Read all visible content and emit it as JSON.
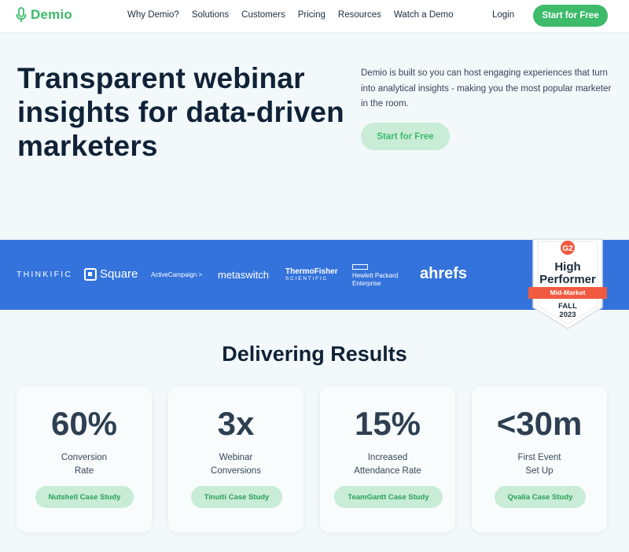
{
  "nav": {
    "logo_text": "Demio",
    "links": [
      "Why Demio?",
      "Solutions",
      "Customers",
      "Pricing",
      "Resources",
      "Watch a Demo"
    ],
    "login": "Login",
    "cta": "Start for Free"
  },
  "hero": {
    "title": "Transparent webinar insights for data-driven marketers",
    "description": "Demio is built so you can host engaging experiences that turn into analytical insights - making you the most popular marketer in the room.",
    "cta": "Start for Free"
  },
  "brands": {
    "thinkific": "THINKIFIC",
    "square": "Square",
    "activecampaign": "ActiveCampaign >",
    "metaswitch": "metaswitch",
    "thermo_line1": "ThermoFisher",
    "thermo_line2": "SCIENTIFIC",
    "hpe_line1": "Hewlett Packard",
    "hpe_line2": "Enterprise",
    "ahrefs": "ahrefs"
  },
  "badge": {
    "line1": "High",
    "line2": "Performer",
    "ribbon": "Mid-Market",
    "season": "FALL",
    "year": "2023"
  },
  "results": {
    "title": "Delivering Results",
    "cards": [
      {
        "stat": "60%",
        "label_line1": "Conversion",
        "label_line2": "Rate",
        "cta": "Nutshell Case Study"
      },
      {
        "stat": "3x",
        "label_line1": "Webinar",
        "label_line2": "Conversions",
        "cta": "Tinuiti Case Study"
      },
      {
        "stat": "15%",
        "label_line1": "Increased",
        "label_line2": "Attendance Rate",
        "cta": "TeamGantt Case Study"
      },
      {
        "stat": "<30m",
        "label_line1": "First Event",
        "label_line2": "Set Up",
        "cta": "Qvalia Case Study"
      }
    ]
  },
  "colors": {
    "brand_green": "#3dbb6a",
    "light_green": "#c8ecd6",
    "band_blue": "#3473dc",
    "badge_red": "#f05a40",
    "heading_navy": "#0f2237"
  }
}
